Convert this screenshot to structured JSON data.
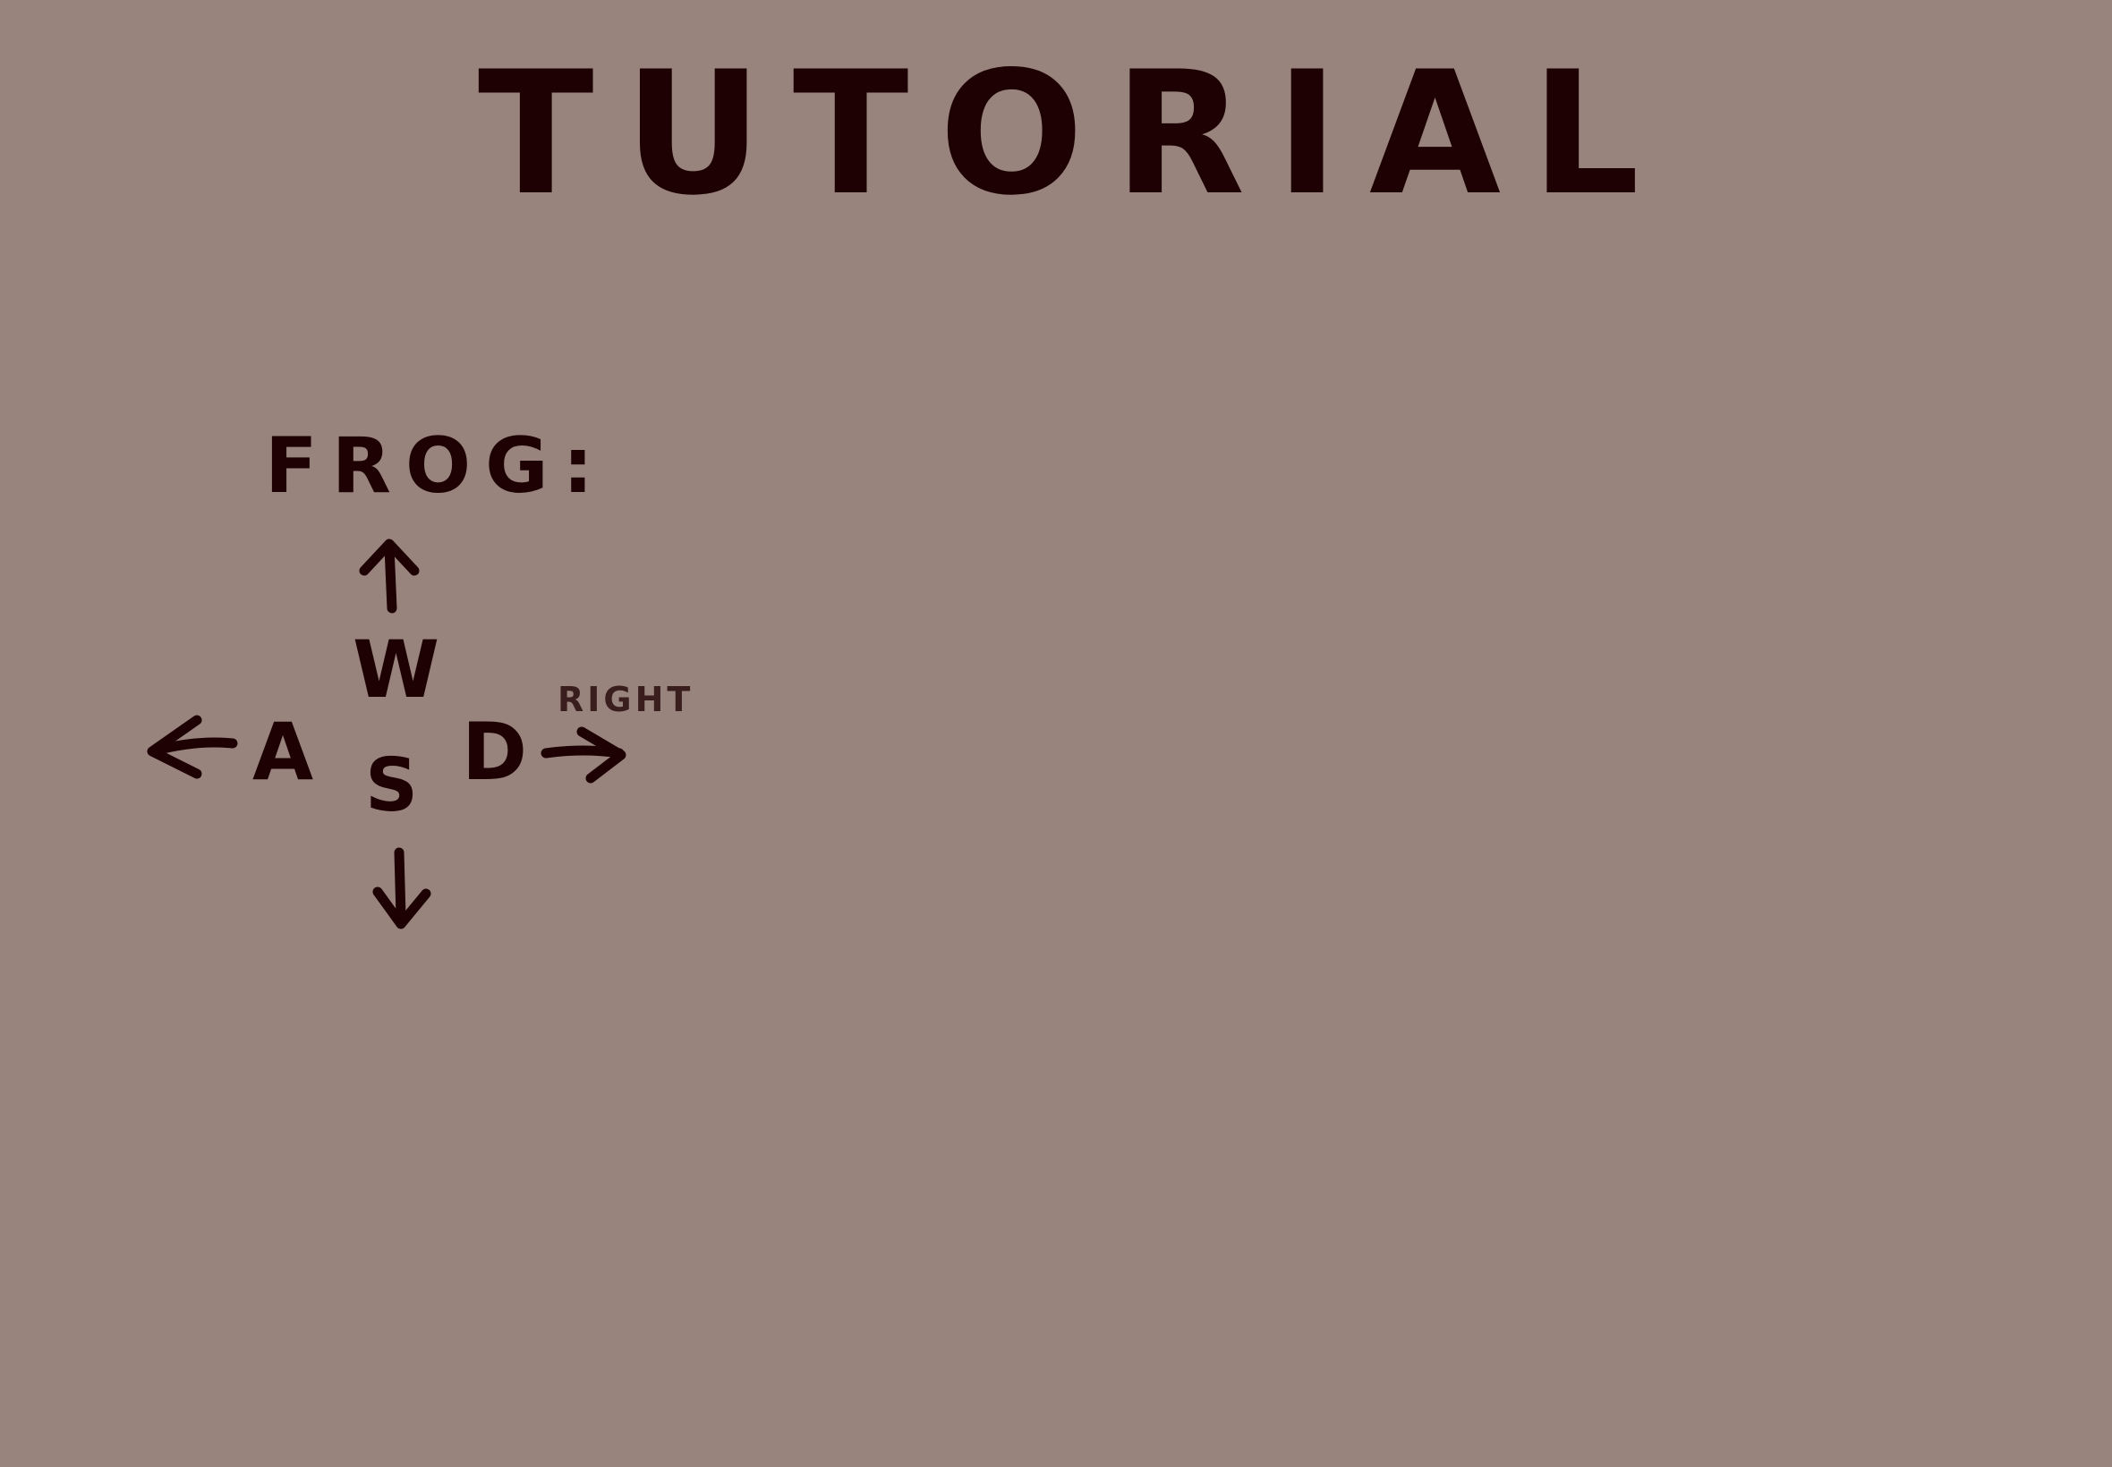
{
  "screen": {
    "title": "TUTORIAL",
    "background_color": "#98847d",
    "ink_color": "#1e0103"
  },
  "controls": {
    "label": "FROG:",
    "keys": {
      "up": "W",
      "left": "A",
      "down": "S",
      "right": "D"
    },
    "right_hint": "RIGHT",
    "arrows": [
      "arrow-up-icon",
      "arrow-left-icon",
      "arrow-down-icon",
      "arrow-right-icon"
    ]
  }
}
